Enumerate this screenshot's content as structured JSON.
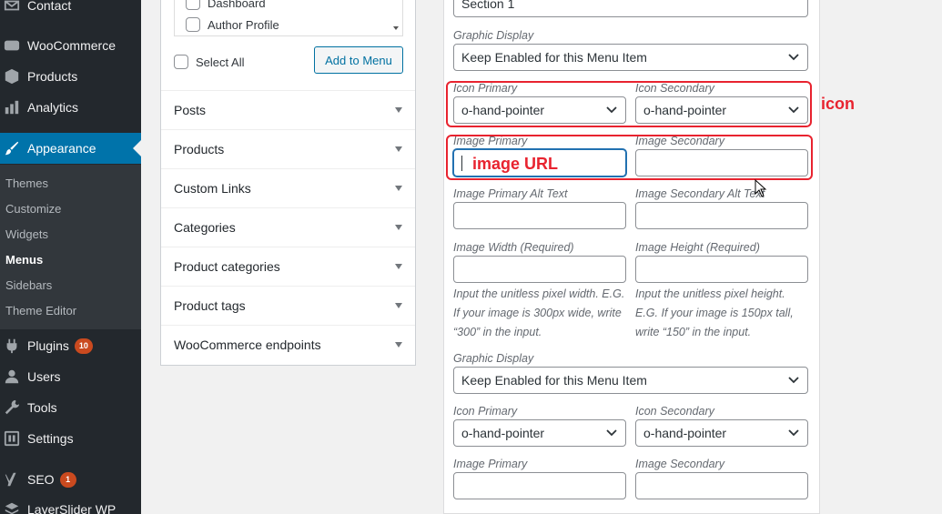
{
  "sidebar": {
    "items": [
      {
        "label": "Contact",
        "icon": "mail-icon"
      },
      {
        "label": "WooCommerce",
        "icon": "woo-icon"
      },
      {
        "label": "Products",
        "icon": "cube-icon"
      },
      {
        "label": "Analytics",
        "icon": "bar-chart-icon"
      },
      {
        "label": "Appearance",
        "icon": "brush-icon",
        "active": true
      },
      {
        "label": "Plugins",
        "icon": "plug-icon",
        "badge": "10"
      },
      {
        "label": "Users",
        "icon": "user-icon"
      },
      {
        "label": "Tools",
        "icon": "wrench-icon"
      },
      {
        "label": "Settings",
        "icon": "settings-icon"
      },
      {
        "label": "SEO",
        "icon": "yoast-icon",
        "badge": "1"
      },
      {
        "label": "LayerSlider WP",
        "icon": "layers-icon"
      }
    ],
    "submenu": [
      "Themes",
      "Customize",
      "Widgets",
      "Menus",
      "Sidebars",
      "Theme Editor"
    ],
    "current_submenu": "Menus"
  },
  "menu_items_box": {
    "checklist": [
      "Dashboard",
      "Author Profile"
    ],
    "select_all": "Select All",
    "add_button": "Add to Menu",
    "accordions": [
      "Posts",
      "Products",
      "Custom Links",
      "Categories",
      "Product categories",
      "Product tags",
      "WooCommerce endpoints"
    ]
  },
  "settings": {
    "section_value": "Section 1",
    "graphic_display_label": "Graphic Display",
    "graphic_display_value": "Keep Enabled for this Menu Item",
    "icon_primary_label": "Icon Primary",
    "icon_secondary_label": "Icon Secondary",
    "icon_primary_value": "o-hand-pointer",
    "icon_secondary_value": "o-hand-pointer",
    "image_primary_label": "Image Primary",
    "image_secondary_label": "Image Secondary",
    "image_primary_alt_label": "Image Primary Alt Text",
    "image_secondary_alt_label": "Image Secondary Alt Text",
    "image_width_label": "Image Width (Required)",
    "image_height_label": "Image Height (Required)",
    "width_help": [
      "Input the unitless pixel width. E.G.",
      "If your image is 300px wide, write",
      "“300” in the input."
    ],
    "height_help": [
      "Input the unitless pixel height.",
      "E.G. If your image is 150px tall,",
      "write “150” in the input."
    ],
    "graphic_display_label_2": "Graphic Display",
    "graphic_display_value_2": "Keep Enabled for this Menu Item",
    "icon_primary_label_2": "Icon Primary",
    "icon_secondary_label_2": "Icon Secondary",
    "icon_primary_value_2": "o-hand-pointer",
    "icon_secondary_value_2": "o-hand-pointer",
    "image_primary_label_2": "Image Primary",
    "image_secondary_label_2": "Image Secondary"
  },
  "annotations": {
    "icon_note": "icon",
    "image_note": "image URL",
    "color": "#e8232f"
  },
  "colors": {
    "sidebar_bg": "#23282d",
    "submenu_bg": "#32373c",
    "active": "#0073aa",
    "badge": "#ca4a1f",
    "focus": "#2271b1"
  }
}
